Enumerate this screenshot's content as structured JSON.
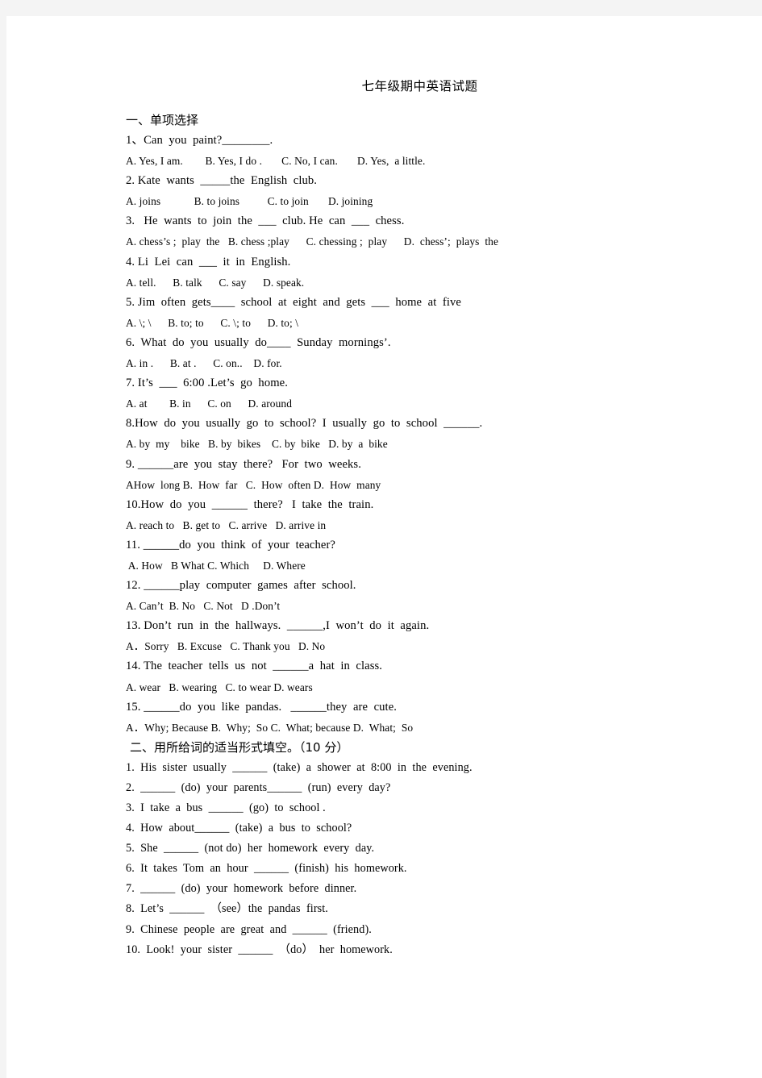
{
  "document": {
    "title": "七年级期中英语试题",
    "sections": [
      {
        "heading": "一、单项选择",
        "heading_name": "section-heading-multiple-choice",
        "lines": [
          {
            "kind": "q",
            "text": "1、Can  you  paint?________."
          },
          {
            "kind": "opt",
            "text": "A. Yes, I am.        B. Yes, I do .       C. No, I can.       D. Yes,  a little."
          },
          {
            "kind": "q",
            "text": "2. Kate  wants  _____the  English  club."
          },
          {
            "kind": "opt",
            "text": "A. joins            B. to joins          C. to join       D. joining"
          },
          {
            "kind": "q",
            "text": "3.   He  wants  to  join  the  ___  club. He  can  ___  chess."
          },
          {
            "kind": "opt",
            "text": "A. chess’s ;  play  the   B. chess ;play      C. chessing ;  play      D.  chess’;  plays  the"
          },
          {
            "kind": "q",
            "text": "4. Li  Lei  can  ___  it  in  English."
          },
          {
            "kind": "opt",
            "text": "A. tell.      B. talk      C. say      D. speak."
          },
          {
            "kind": "q",
            "text": "5. Jim  often  gets____  school  at  eight  and  gets  ___  home  at  five"
          },
          {
            "kind": "opt",
            "text": "A. \\; \\      B. to; to      C. \\; to      D. to; \\"
          },
          {
            "kind": "q",
            "text": "6.  What  do  you  usually  do____  Sunday  mornings’."
          },
          {
            "kind": "opt",
            "text": "A. in .      B. at .      C. on..    D. for."
          },
          {
            "kind": "q",
            "text": "7. It’s  ___  6:00 .Let’s  go  home."
          },
          {
            "kind": "opt",
            "text": "A. at        B. in      C. on      D. around"
          },
          {
            "kind": "q",
            "text": "8.How  do  you  usually  go  to  school?  I  usually  go  to  school  ______."
          },
          {
            "kind": "opt",
            "text": "A. by  my    bike   B. by  bikes    C. by  bike   D. by  a  bike"
          },
          {
            "kind": "q",
            "text": "9. ______are  you  stay  there?   For  two  weeks."
          },
          {
            "kind": "opt",
            "text": "AHow  long B.  How  far   C.  How  often D.  How  many"
          },
          {
            "kind": "q",
            "text": "10.How  do  you  ______  there?   I  take  the  train."
          },
          {
            "kind": "opt",
            "text": "A. reach to   B. get to   C. arrive   D. arrive in"
          },
          {
            "kind": "q",
            "text": "11. ______do  you  think  of  your  teacher?"
          },
          {
            "kind": "opt",
            "text": " A. How   B What C. Which     D. Where"
          },
          {
            "kind": "q",
            "text": "12. ______play  computer  games  after  school."
          },
          {
            "kind": "opt",
            "text": "A. Can’t  B. No   C. Not   D .Don’t"
          },
          {
            "kind": "q",
            "text": "13. Don’t  run  in  the  hallways.  ______,I  won’t  do  it  again."
          },
          {
            "kind": "opt",
            "text": "A．Sorry   B. Excuse   C. Thank you   D. No"
          },
          {
            "kind": "q",
            "text": "14. The  teacher  tells  us  not  ______a  hat  in  class."
          },
          {
            "kind": "opt",
            "text": "A. wear   B. wearing   C. to wear D. wears"
          },
          {
            "kind": "q",
            "text": "15. ______do  you  like  pandas.   ______they  are  cute."
          },
          {
            "kind": "opt",
            "text": "A．Why; Because B.  Why;  So C.  What; because D.  What;  So"
          }
        ]
      },
      {
        "heading": "二、用所给词的适当形式填空。（10 分）",
        "heading_name": "section-heading-word-forms",
        "indent": true,
        "lines": [
          {
            "kind": "sub",
            "text": "1.  His  sister  usually  ______  (take)  a  shower  at  8:00  in  the  evening."
          },
          {
            "kind": "sub",
            "text": "2.  ______  (do)  your  parents______  (run)  every  day?"
          },
          {
            "kind": "sub",
            "text": "3.  I  take  a  bus  ______  (go)  to  school ."
          },
          {
            "kind": "sub",
            "text": "4.  How  about______  (take)  a  bus  to  school?"
          },
          {
            "kind": "sub",
            "text": "5.  She  ______  (not do)  her  homework  every  day."
          },
          {
            "kind": "sub",
            "text": "6.  It  takes  Tom  an  hour  ______  (finish)  his  homework."
          },
          {
            "kind": "sub",
            "text": "7.  ______  (do)  your  homework  before  dinner."
          },
          {
            "kind": "sub",
            "text": "8.  Let’s  ______  （see）the  pandas  first."
          },
          {
            "kind": "sub",
            "text": "9.  Chinese  people  are  great  and  ______  (friend)."
          },
          {
            "kind": "sub",
            "text": "10.  Look!  your  sister  ______  （do）  her  homework."
          }
        ]
      }
    ]
  }
}
